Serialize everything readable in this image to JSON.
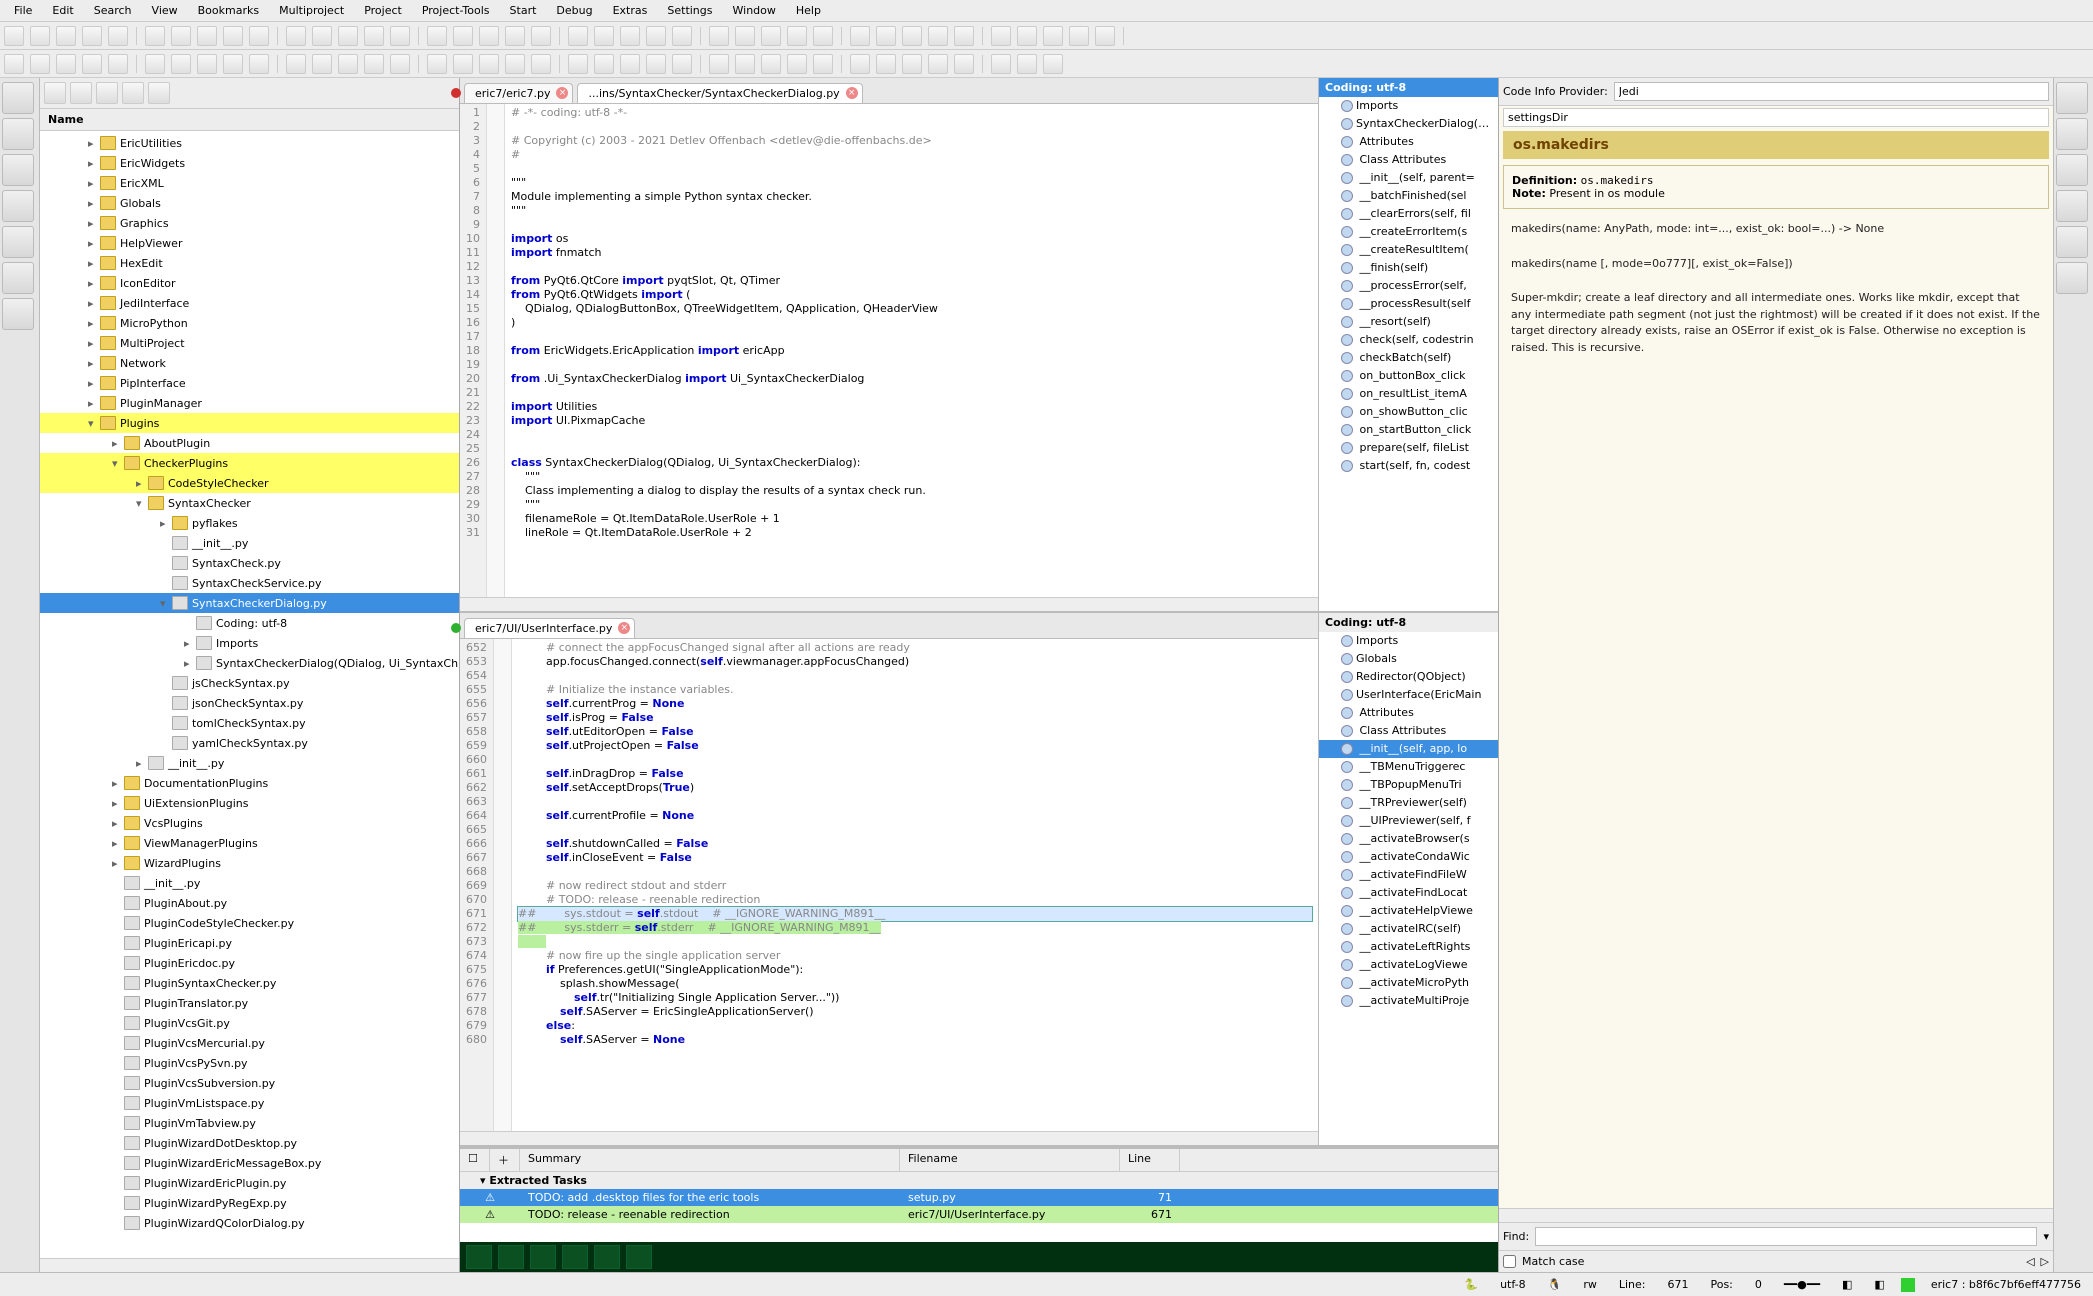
{
  "menu": [
    "File",
    "Edit",
    "Search",
    "View",
    "Bookmarks",
    "Multiproject",
    "Project",
    "Project-Tools",
    "Start",
    "Debug",
    "Extras",
    "Settings",
    "Window",
    "Help"
  ],
  "projectHeader": "Name",
  "tree": [
    {
      "d": 1,
      "exp": "▸",
      "label": "EricUtilities"
    },
    {
      "d": 1,
      "exp": "▸",
      "label": "EricWidgets"
    },
    {
      "d": 1,
      "exp": "▸",
      "label": "EricXML"
    },
    {
      "d": 1,
      "exp": "▸",
      "label": "Globals"
    },
    {
      "d": 1,
      "exp": "▸",
      "label": "Graphics"
    },
    {
      "d": 1,
      "exp": "▸",
      "label": "HelpViewer"
    },
    {
      "d": 1,
      "exp": "▸",
      "label": "HexEdit"
    },
    {
      "d": 1,
      "exp": "▸",
      "label": "IconEditor"
    },
    {
      "d": 1,
      "exp": "▸",
      "label": "JediInterface"
    },
    {
      "d": 1,
      "exp": "▸",
      "label": "MicroPython"
    },
    {
      "d": 1,
      "exp": "▸",
      "label": "MultiProject"
    },
    {
      "d": 1,
      "exp": "▸",
      "label": "Network"
    },
    {
      "d": 1,
      "exp": "▸",
      "label": "PipInterface"
    },
    {
      "d": 1,
      "exp": "▸",
      "label": "PluginManager"
    },
    {
      "d": 1,
      "exp": "▾",
      "label": "Plugins",
      "hl": "yellow"
    },
    {
      "d": 2,
      "exp": "▸",
      "label": "AboutPlugin"
    },
    {
      "d": 2,
      "exp": "▾",
      "label": "CheckerPlugins",
      "hl": "yellow"
    },
    {
      "d": 3,
      "exp": "▸",
      "label": "CodeStyleChecker",
      "hl": "yellow"
    },
    {
      "d": 3,
      "exp": "▾",
      "label": "SyntaxChecker"
    },
    {
      "d": 4,
      "exp": "▸",
      "label": "pyflakes"
    },
    {
      "d": 4,
      "exp": "",
      "label": "__init__.py",
      "file": true
    },
    {
      "d": 4,
      "exp": "",
      "label": "SyntaxCheck.py",
      "file": true
    },
    {
      "d": 4,
      "exp": "",
      "label": "SyntaxCheckService.py",
      "file": true
    },
    {
      "d": 4,
      "exp": "▾",
      "label": "SyntaxCheckerDialog.py",
      "file": true,
      "hl": "sel"
    },
    {
      "d": 5,
      "exp": "",
      "label": "Coding: utf-8",
      "file": true
    },
    {
      "d": 5,
      "exp": "▸",
      "label": "Imports",
      "file": true
    },
    {
      "d": 5,
      "exp": "▸",
      "label": "SyntaxCheckerDialog(QDialog, Ui_SyntaxCh",
      "file": true
    },
    {
      "d": 4,
      "exp": "",
      "label": "jsCheckSyntax.py",
      "file": true
    },
    {
      "d": 4,
      "exp": "",
      "label": "jsonCheckSyntax.py",
      "file": true
    },
    {
      "d": 4,
      "exp": "",
      "label": "tomlCheckSyntax.py",
      "file": true
    },
    {
      "d": 4,
      "exp": "",
      "label": "yamlCheckSyntax.py",
      "file": true
    },
    {
      "d": 3,
      "exp": "▸",
      "label": "__init__.py",
      "file": true
    },
    {
      "d": 2,
      "exp": "▸",
      "label": "DocumentationPlugins"
    },
    {
      "d": 2,
      "exp": "▸",
      "label": "UiExtensionPlugins"
    },
    {
      "d": 2,
      "exp": "▸",
      "label": "VcsPlugins"
    },
    {
      "d": 2,
      "exp": "▸",
      "label": "ViewManagerPlugins"
    },
    {
      "d": 2,
      "exp": "▸",
      "label": "WizardPlugins"
    },
    {
      "d": 2,
      "exp": "",
      "label": "__init__.py",
      "file": true
    },
    {
      "d": 2,
      "exp": "",
      "label": "PluginAbout.py",
      "file": true
    },
    {
      "d": 2,
      "exp": "",
      "label": "PluginCodeStyleChecker.py",
      "file": true
    },
    {
      "d": 2,
      "exp": "",
      "label": "PluginEricapi.py",
      "file": true
    },
    {
      "d": 2,
      "exp": "",
      "label": "PluginEricdoc.py",
      "file": true
    },
    {
      "d": 2,
      "exp": "",
      "label": "PluginSyntaxChecker.py",
      "file": true
    },
    {
      "d": 2,
      "exp": "",
      "label": "PluginTranslator.py",
      "file": true
    },
    {
      "d": 2,
      "exp": "",
      "label": "PluginVcsGit.py",
      "file": true
    },
    {
      "d": 2,
      "exp": "",
      "label": "PluginVcsMercurial.py",
      "file": true
    },
    {
      "d": 2,
      "exp": "",
      "label": "PluginVcsPySvn.py",
      "file": true
    },
    {
      "d": 2,
      "exp": "",
      "label": "PluginVcsSubversion.py",
      "file": true
    },
    {
      "d": 2,
      "exp": "",
      "label": "PluginVmListspace.py",
      "file": true
    },
    {
      "d": 2,
      "exp": "",
      "label": "PluginVmTabview.py",
      "file": true
    },
    {
      "d": 2,
      "exp": "",
      "label": "PluginWizardDotDesktop.py",
      "file": true
    },
    {
      "d": 2,
      "exp": "",
      "label": "PluginWizardEricMessageBox.py",
      "file": true
    },
    {
      "d": 2,
      "exp": "",
      "label": "PluginWizardEricPlugin.py",
      "file": true
    },
    {
      "d": 2,
      "exp": "",
      "label": "PluginWizardPyRegExp.py",
      "file": true
    },
    {
      "d": 2,
      "exp": "",
      "label": "PluginWizardQColorDialog.py",
      "file": true
    }
  ],
  "editor1": {
    "tabs": [
      {
        "label": "eric7/eric7.py",
        "dot": "#d03030"
      },
      {
        "label": "...ins/SyntaxChecker/SyntaxCheckerDialog.py",
        "dot": "",
        "active": true
      }
    ],
    "startLine": 1,
    "lines": [
      "# -*- coding: utf-8 -*-",
      "",
      "# Copyright (c) 2003 - 2021 Detlev Offenbach <detlev@die-offenbachs.de>",
      "#",
      "",
      "\"\"\"",
      "Module implementing a simple Python syntax checker.",
      "\"\"\"",
      "",
      "import os",
      "import fnmatch",
      "",
      "from PyQt6.QtCore import pyqtSlot, Qt, QTimer",
      "from PyQt6.QtWidgets import (",
      "    QDialog, QDialogButtonBox, QTreeWidgetItem, QApplication, QHeaderView",
      ")",
      "",
      "from EricWidgets.EricApplication import ericApp",
      "",
      "from .Ui_SyntaxCheckerDialog import Ui_SyntaxCheckerDialog",
      "",
      "import Utilities",
      "import UI.PixmapCache",
      "",
      "",
      "class SyntaxCheckerDialog(QDialog, Ui_SyntaxCheckerDialog):",
      "    \"\"\"",
      "    Class implementing a dialog to display the results of a syntax check run.",
      "    \"\"\"",
      "    filenameRole = Qt.ItemDataRole.UserRole + 1",
      "    lineRole = Qt.ItemDataRole.UserRole + 2"
    ],
    "outline": {
      "head": "Coding: utf-8",
      "items": [
        "Imports",
        "SyntaxCheckerDialog(QDia",
        "  Attributes",
        "  Class Attributes",
        "  __init__(self, parent=",
        "  __batchFinished(sel",
        "  __clearErrors(self, fil",
        "  __createErrorItem(s",
        "  __createResultItem(",
        "  __finish(self)",
        "  __processError(self,",
        "  __processResult(self",
        "  __resort(self)",
        "  check(self, codestrin",
        "  checkBatch(self)",
        "  on_buttonBox_click",
        "  on_resultList_itemA",
        "  on_showButton_clic",
        "  on_startButton_click",
        "  prepare(self, fileList",
        "  start(self, fn, codest"
      ]
    }
  },
  "editor2": {
    "tabs": [
      {
        "label": "eric7/UI/UserInterface.py",
        "dot": "#30b030",
        "active": true
      }
    ],
    "startLine": 652,
    "lines": [
      "        # connect the appFocusChanged signal after all actions are ready",
      "        app.focusChanged.connect(self.viewmanager.appFocusChanged)",
      "        ",
      "        # Initialize the instance variables.",
      "        self.currentProg = None",
      "        self.isProg = False",
      "        self.utEditorOpen = False",
      "        self.utProjectOpen = False",
      "        ",
      "        self.inDragDrop = False",
      "        self.setAcceptDrops(True)",
      "        ",
      "        self.currentProfile = None",
      "        ",
      "        self.shutdownCalled = False",
      "        self.inCloseEvent = False",
      "        ",
      "        # now redirect stdout and stderr",
      "        # TODO: release - reenable redirection",
      "##        sys.stdout = self.stdout    # __IGNORE_WARNING_M891__",
      "##        sys.stderr = self.stderr    # __IGNORE_WARNING_M891__",
      "        ",
      "        # now fire up the single application server",
      "        if Preferences.getUI(\"SingleApplicationMode\"):",
      "            splash.showMessage(",
      "                self.tr(\"Initializing Single Application Server...\"))",
      "            self.SAServer = EricSingleApplicationServer()",
      "        else:",
      "            self.SAServer = None"
    ],
    "outline": {
      "head": "Coding: utf-8",
      "items": [
        "Imports",
        "Globals",
        "Redirector(QObject)",
        "UserInterface(EricMain",
        "  Attributes",
        "  Class Attributes",
        "  __init__(self, app, lo",
        "  __TBMenuTriggerec",
        "  __TBPopupMenuTri",
        "  __TRPreviewer(self)",
        "  __UIPreviewer(self, f",
        "  __activateBrowser(s",
        "  __activateCondaWic",
        "  __activateFindFileW",
        "  __activateFindLocat",
        "  __activateHelpViewe",
        "  __activateIRC(self)",
        "  __activateLeftRights",
        "  __activateLogViewe",
        "  __activateMicroPyth",
        "  __activateMultiProje"
      ],
      "selIndex": 6
    }
  },
  "tasks": {
    "cols": [
      "Summary",
      "Filename",
      "Line"
    ],
    "group": "Extracted Tasks",
    "rows": [
      {
        "summary": "TODO: add .desktop files for the eric tools",
        "file": "setup.py",
        "line": "71",
        "sel": true
      },
      {
        "summary": "TODO: release - reenable redirection",
        "file": "eric7/UI/UserInterface.py",
        "line": "671",
        "warn": true
      }
    ]
  },
  "info": {
    "providerLabel": "Code Info Provider:",
    "provider": "Jedi",
    "search": "settingsDir",
    "title": "os.makedirs",
    "defLabel": "Definition:",
    "defValue": "os.makedirs",
    "noteLabel": "Note:",
    "noteValue": "Present in os module",
    "sig1": "makedirs(name: AnyPath, mode: int=..., exist_ok: bool=...) -> None",
    "sig2": "makedirs(name [, mode=0o777][, exist_ok=False])",
    "body": "Super-mkdir; create a leaf directory and all intermediate ones. Works like mkdir, except that any intermediate path segment (not just the rightmost) will be created if it does not exist. If the target directory already exists, raise an OSError if exist_ok is False. Otherwise no exception is raised. This is recursive.",
    "findLabel": "Find:",
    "matchCase": "Match case"
  },
  "status": {
    "enc": "utf-8",
    "rw": "rw",
    "lineLabel": "Line:",
    "line": "671",
    "posLabel": "Pos:",
    "pos": "0",
    "path": "eric7 : b8f6c7bf6eff477756"
  }
}
